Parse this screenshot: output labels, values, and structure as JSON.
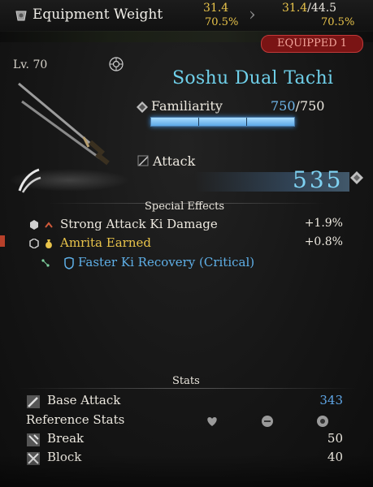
{
  "header": {
    "title": "Equipment Weight",
    "current_weight": "31.4",
    "current_pct": "70.5%",
    "new_weight": "31.4",
    "new_max": "44.5",
    "new_pct": "70.5%",
    "slash": "/"
  },
  "badge": {
    "equipped": "EQUIPPED 1"
  },
  "weapon": {
    "level": "Lv. 70",
    "name": "Soshu Dual Tachi",
    "familiarity_label": "Familiarity",
    "familiarity_value": "750",
    "familiarity_max": "750",
    "familiarity_fraction": 1.0,
    "attack_label": "Attack",
    "attack_value": "535"
  },
  "special_effects": {
    "title": "Special Effects",
    "items": [
      {
        "label": "Strong Attack Ki Damage",
        "value": "+1.9%"
      },
      {
        "label": "Amrita Earned",
        "value": "+0.8%"
      }
    ],
    "critical": "Faster Ki Recovery (Critical)"
  },
  "stats": {
    "title": "Stats",
    "base_attack_label": "Base Attack",
    "base_attack_value": "343",
    "reference_label": "Reference Stats",
    "break_label": "Break",
    "break_value": "50",
    "block_label": "Block",
    "block_value": "40"
  },
  "colors": {
    "accent_blue": "#6fd0ea",
    "gold": "#e8c34a",
    "equipped_red": "#7a1414"
  }
}
